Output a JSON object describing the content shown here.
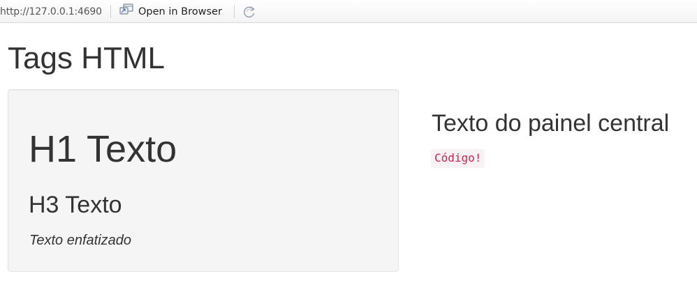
{
  "toolbar": {
    "url": "http://127.0.0.1:4690",
    "open_browser_label": "Open in Browser",
    "icons": {
      "open_browser": "open-in-browser-icon",
      "refresh": "refresh-icon"
    }
  },
  "page": {
    "title": "Tags HTML",
    "sidebar": {
      "h1": "H1 Texto",
      "h3": "H3 Texto",
      "em": "Texto enfatizado"
    },
    "main": {
      "h3": "Texto do painel central",
      "code": "Código!"
    }
  },
  "colors": {
    "text": "#333333",
    "well_background": "#f5f5f5",
    "well_border": "#e3e3e3",
    "code_text": "#c7254e",
    "code_background": "#f9f2f4"
  }
}
